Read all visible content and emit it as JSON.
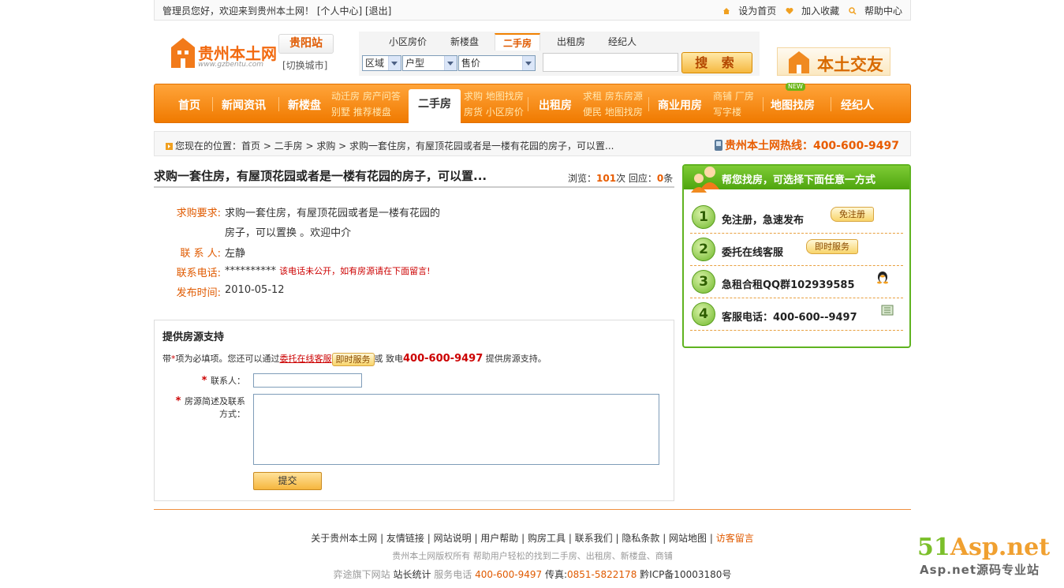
{
  "topbar": {
    "greeting": "管理员您好，欢迎来到贵州本土网！ [个人中心] [退出]",
    "set_home": "设为首页",
    "add_fav": "加入收藏",
    "help": "帮助中心"
  },
  "header": {
    "logo_text": "贵州本土网",
    "logo_url": "www.gzbentu.com",
    "city": "贵阳站",
    "switch_city": "[切换城市]",
    "jiaoyou": "本土交友"
  },
  "search": {
    "tabs": [
      "小区房价",
      "新楼盘",
      "二手房",
      "出租房",
      "经纪人"
    ],
    "active_tab": "二手房",
    "selects": [
      "区域",
      "户型",
      "售价"
    ],
    "button": "搜 索"
  },
  "nav": {
    "items": [
      "首页",
      "新闻资讯",
      "新楼盘",
      "二手房",
      "出租房",
      "商业用房",
      "地图找房",
      "经纪人"
    ],
    "sub_newhouse": [
      "动迁房 房产问答",
      "别墅 推荐楼盘"
    ],
    "sub_second": [
      "求购 地图找房",
      "房货 小区房价"
    ],
    "sub_rent": [
      "求租 房东房源",
      "便民 地图找房"
    ],
    "sub_biz": [
      "商铺 厂房",
      "写字楼"
    ],
    "new_badge": "NEW"
  },
  "breadcrumb": {
    "text": "您现在的位置：首页 > 二手房 > 求购 > 求购一套住房，有屋顶花园或者是一楼有花园的房子，可以置...",
    "hotline": "贵州本土网热线：400-600-9497"
  },
  "post": {
    "title": "求购一套住房，有屋顶花园或者是一楼有花园的房子，可以置...",
    "views_label": "浏览：",
    "views": "101",
    "views_unit": "次 回应：",
    "replies": "0",
    "replies_unit": "条",
    "req_label": "求购要求:",
    "req_line1": "求购一套住房，有屋顶花园或者是一楼有花园的",
    "req_line2": "房子，可以置换 。欢迎中介",
    "contact_label": "联 系 人:",
    "contact": "左静",
    "phone_label": "联系电话:",
    "phone": "**********",
    "phone_note": "该电话未公开，如有房源请在下面留言!",
    "time_label": "发布时间:",
    "time": "2010-05-12"
  },
  "form": {
    "heading": "提供房源支持",
    "tip_a": "带",
    "tip_star": "*",
    "tip_b": "项为必填项。您还可以通过",
    "tip_link": "委托在线客服",
    "tip_btn": "即时服务",
    "tip_c": "或 致电",
    "tip_tel": "400-600-9497",
    "tip_d": "提供房源支持。",
    "field1": "联系人：",
    "field2_a": "房源简述及联系",
    "field2_b": "方式：",
    "submit": "提交"
  },
  "side": {
    "title": "帮您找房，可选择下面任意一方式",
    "steps": [
      {
        "num": "1",
        "text": "免注册，急速发布",
        "btn": "免注册"
      },
      {
        "num": "2",
        "text": "委托在线客服",
        "btn": "即时服务"
      },
      {
        "num": "3",
        "text": "急租合租QQ群102939585"
      },
      {
        "num": "4",
        "text": "客服电话：400-600--9497"
      }
    ]
  },
  "footer": {
    "links": [
      "关于贵州本土网",
      "友情链接",
      "网站说明",
      "用户帮助",
      "购房工具",
      "联系我们",
      "隐私条款",
      "网站地图",
      "访客留言"
    ],
    "copy": "贵州本土网版权所有 帮助用户轻松的找到二手房、出租房、新楼盘、商铺",
    "info_a": "弈途旗下网站",
    "info_b": "站长统计",
    "info_c": "服务电话",
    "info_tel": "400-600-9497",
    "info_fax_label": "传真:",
    "info_fax": "0851-5822178",
    "info_icp": "黔ICP备10003180号"
  },
  "watermark": {
    "big_a": "51",
    "big_b": "Asp.net",
    "small": "Asp.net源码专业站"
  }
}
